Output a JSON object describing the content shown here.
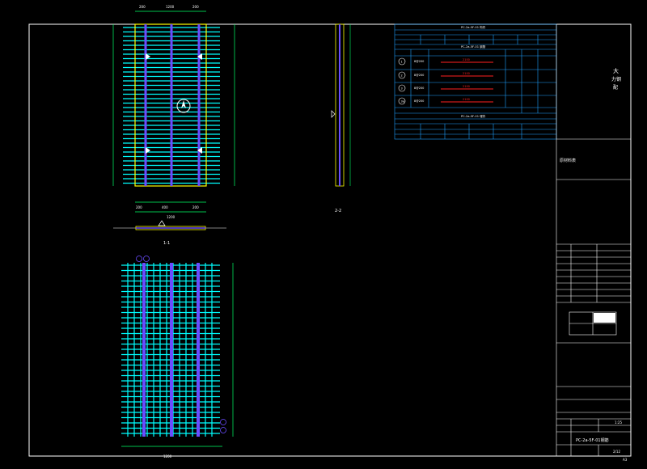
{
  "drawing": {
    "title_block": {
      "company_line1": "大",
      "company_line2": "力钢",
      "company_line3": "配",
      "project_label": "原材料表",
      "drawing_no": "PC-2a-5F-01钢筋",
      "scale_label": "1:25",
      "sheet_label": "2/12",
      "page_mark": "A3"
    },
    "views": {
      "section_1": "1-1",
      "section_2": "2-2",
      "top_width": "1200",
      "bottom_width": "1200"
    },
    "tables": {
      "table1_title": "PC-2a-5F-01 构件",
      "table2_title": "PC-2a-5F-01 钢筋",
      "table3_title": "PC-2a-5F-01 埋件",
      "rebar_ids": [
        "1",
        "2",
        "3",
        "3a"
      ],
      "rebar_specs": [
        "8@200",
        "8@200",
        "8@200",
        "8@200"
      ],
      "rebar_lengths": [
        "2100",
        "2100",
        "2100",
        "2100"
      ]
    },
    "colors": {
      "frame": "#ffffff",
      "rebar_cyan": "#00ffff",
      "rebar_purple": "#5a46ff",
      "outline_yellow": "#ffff00",
      "dim_green": "#00ff66",
      "red": "#ff2020",
      "table_blue": "#1ea0ff"
    }
  }
}
